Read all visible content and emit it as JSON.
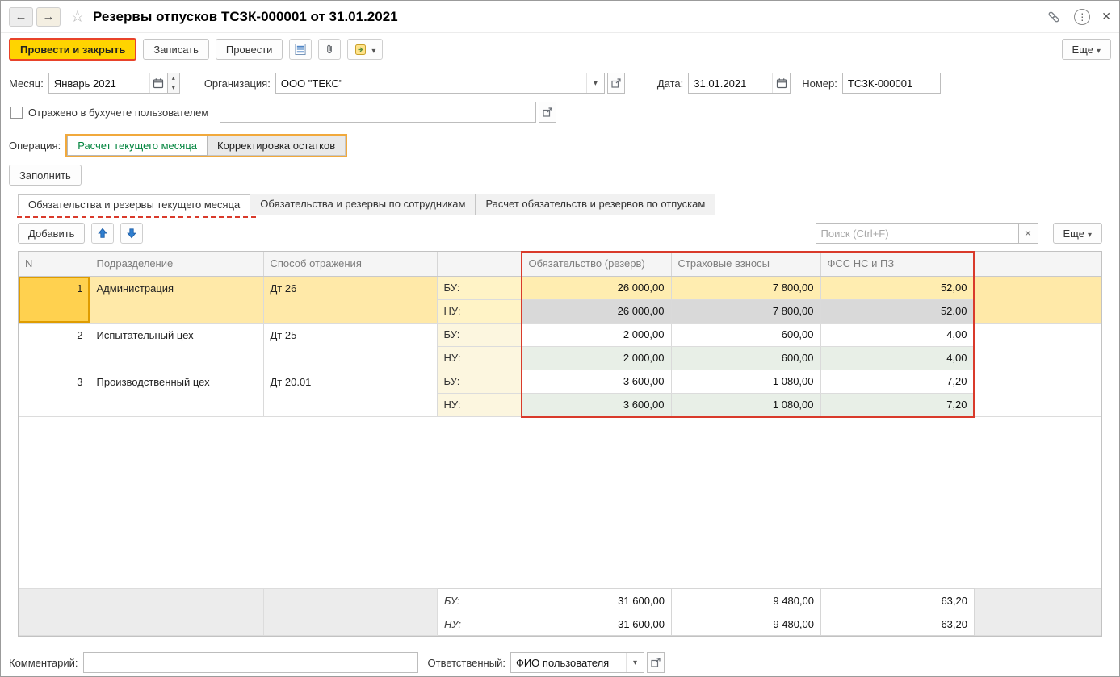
{
  "window": {
    "title": "Резервы отпусков ТСЗК-000001 от 31.01.2021"
  },
  "icons": {
    "back": "←",
    "forward": "→",
    "star": "☆",
    "close": "✕",
    "menu": "⋮",
    "clear": "✕"
  },
  "toolbar": {
    "post_close": "Провести и закрыть",
    "save": "Записать",
    "post": "Провести",
    "more": "Еще"
  },
  "header": {
    "month_label": "Месяц:",
    "month_value": "Январь 2021",
    "org_label": "Организация:",
    "org_value": "ООО \"ТЕКС\"",
    "date_label": "Дата:",
    "date_value": "31.01.2021",
    "number_label": "Номер:",
    "number_value": "ТСЗК-000001",
    "reflected_label": "Отражено в бухучете пользователем",
    "operation_label": "Операция:",
    "operation_selected": "Расчет текущего месяца",
    "operation_other": "Корректировка остатков",
    "fill_button": "Заполнить"
  },
  "tabs": [
    {
      "label": "Обязательства и резервы текущего месяца"
    },
    {
      "label": "Обязательства и резервы по сотрудникам"
    },
    {
      "label": "Расчет обязательств и резервов по отпускам"
    }
  ],
  "table_toolbar": {
    "add": "Добавить",
    "search_placeholder": "Поиск (Ctrl+F)",
    "more": "Еще"
  },
  "table": {
    "columns": [
      "N",
      "Подразделение",
      "Способ отражения",
      "Обязательство (резерв)",
      "Страховые взносы",
      "ФСС НС и ПЗ"
    ],
    "bu_label": "БУ:",
    "nu_label": "НУ:",
    "rows": [
      {
        "n": "1",
        "department": "Администрация",
        "method": "Дт 26",
        "bu": [
          "26 000,00",
          "7 800,00",
          "52,00"
        ],
        "nu": [
          "26 000,00",
          "7 800,00",
          "52,00"
        ]
      },
      {
        "n": "2",
        "department": "Испытательный цех",
        "method": "Дт 25",
        "bu": [
          "2 000,00",
          "600,00",
          "4,00"
        ],
        "nu": [
          "2 000,00",
          "600,00",
          "4,00"
        ]
      },
      {
        "n": "3",
        "department": "Производственный цех",
        "method": "Дт 20.01",
        "bu": [
          "3 600,00",
          "1 080,00",
          "7,20"
        ],
        "nu": [
          "3 600,00",
          "1 080,00",
          "7,20"
        ]
      }
    ],
    "totals": {
      "bu": [
        "31 600,00",
        "9 480,00",
        "63,20"
      ],
      "nu": [
        "31 600,00",
        "9 480,00",
        "63,20"
      ]
    }
  },
  "footer": {
    "comment_label": "Комментарий:",
    "responsible_label": "Ответственный:",
    "responsible_value": "ФИО пользователя"
  }
}
